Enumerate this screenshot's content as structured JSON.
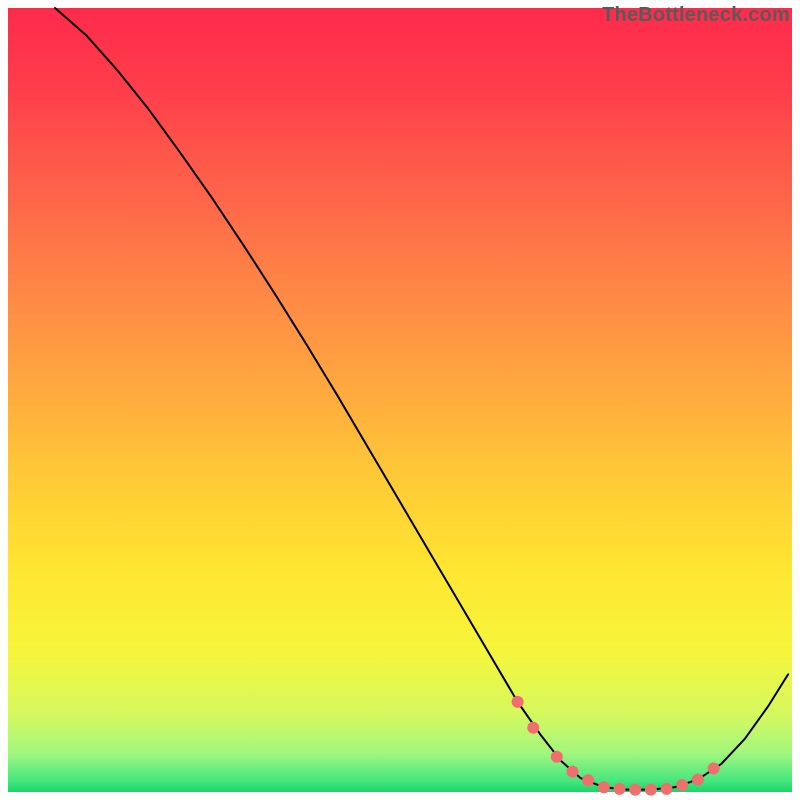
{
  "watermark": "TheBottleneck.com",
  "chart_data": {
    "type": "line",
    "title": "",
    "xlabel": "",
    "ylabel": "",
    "xlim": [
      0,
      100
    ],
    "ylim": [
      0,
      100
    ],
    "grid": false,
    "background_gradient": {
      "stops": [
        {
          "offset": 0.0,
          "color": "#ff2a4b"
        },
        {
          "offset": 0.1,
          "color": "#ff3d4b"
        },
        {
          "offset": 0.22,
          "color": "#ff5f4a"
        },
        {
          "offset": 0.35,
          "color": "#ff8446"
        },
        {
          "offset": 0.48,
          "color": "#ffa73f"
        },
        {
          "offset": 0.6,
          "color": "#ffca36"
        },
        {
          "offset": 0.72,
          "color": "#ffe631"
        },
        {
          "offset": 0.82,
          "color": "#f6f53b"
        },
        {
          "offset": 0.9,
          "color": "#d6f85e"
        },
        {
          "offset": 0.95,
          "color": "#a2f77d"
        },
        {
          "offset": 0.985,
          "color": "#48e77f"
        },
        {
          "offset": 1.0,
          "color": "#19d668"
        }
      ]
    },
    "series": [
      {
        "name": "bottleneck-curve",
        "color": "#000000",
        "stroke_width": 2,
        "x": [
          6.0,
          10.0,
          14.0,
          18.0,
          22.0,
          26.0,
          30.0,
          34.0,
          38.0,
          42.0,
          46.0,
          50.0,
          54.0,
          58.0,
          62.0,
          65.0,
          68.0,
          70.5,
          73.0,
          76.0,
          79.0,
          82.0,
          85.0,
          88.0,
          91.0,
          94.0,
          97.0,
          99.5
        ],
        "y": [
          100.0,
          96.5,
          92.0,
          87.0,
          81.5,
          75.8,
          69.8,
          63.6,
          57.2,
          50.6,
          43.8,
          37.0,
          30.2,
          23.4,
          16.6,
          11.5,
          7.2,
          4.0,
          1.8,
          0.6,
          0.3,
          0.3,
          0.6,
          1.6,
          3.6,
          6.8,
          11.0,
          15.0
        ]
      }
    ],
    "markers": {
      "name": "sweet-spot-markers",
      "color": "#ef6f6f",
      "radius": 6,
      "x": [
        65.0,
        67.0,
        70.0,
        72.0,
        74.0,
        76.0,
        78.0,
        80.0,
        82.0,
        84.0,
        86.0,
        88.0,
        90.0
      ],
      "y": [
        11.5,
        8.2,
        4.5,
        2.6,
        1.5,
        0.6,
        0.4,
        0.3,
        0.3,
        0.4,
        0.9,
        1.6,
        3.0
      ]
    }
  }
}
